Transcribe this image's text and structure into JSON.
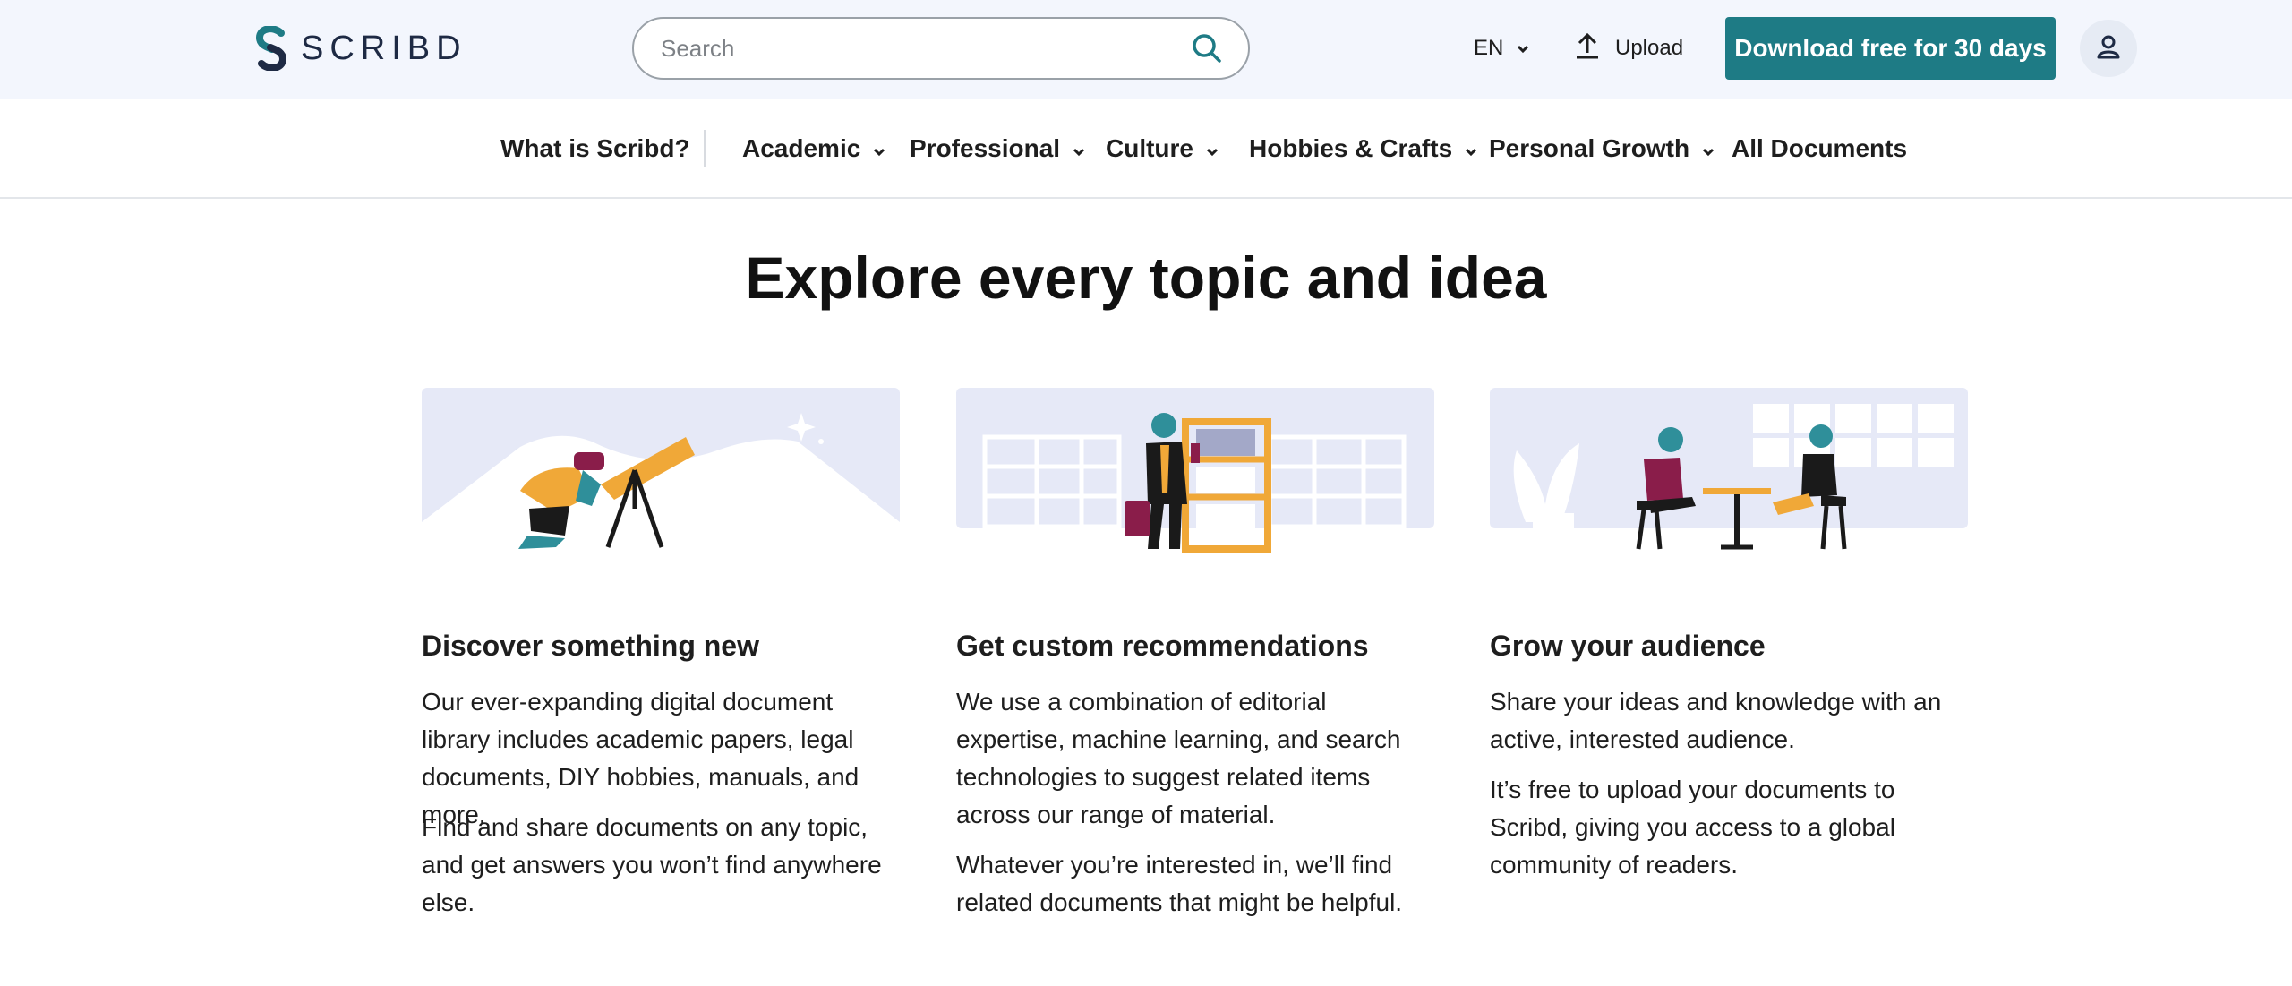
{
  "header": {
    "logo_text": "SCRIBD",
    "search_placeholder": "Search",
    "language": "EN",
    "upload_label": "Upload",
    "cta_label": "Download free for 30 days",
    "brand_color": "#1e7b85",
    "icons": [
      "scribd-logo-icon",
      "search-icon",
      "chevron-down-icon",
      "upload-icon",
      "user-icon"
    ]
  },
  "nav": {
    "items": [
      {
        "label": "What is Scribd?",
        "dropdown": false
      },
      {
        "label": "Academic",
        "dropdown": true
      },
      {
        "label": "Professional",
        "dropdown": true
      },
      {
        "label": "Culture",
        "dropdown": true
      },
      {
        "label": "Hobbies & Crafts",
        "dropdown": true
      },
      {
        "label": "Personal Growth",
        "dropdown": true
      },
      {
        "label": "All Documents",
        "dropdown": false
      }
    ]
  },
  "main": {
    "headline": "Explore every topic and idea",
    "cards": [
      {
        "title": "Discover something new",
        "p1": "Our ever-expanding digital document library includes academic papers, legal documents, DIY hobbies, manuals, and more.",
        "p2": "Find and share documents on any topic, and get answers you won’t find anywhere else."
      },
      {
        "title": "Get custom recommendations",
        "p1": "We use a combination of editorial expertise, machine learning, and search technologies to suggest related items across our range of material.",
        "p2": "Whatever you’re interested in, we’ll find related documents that might be helpful."
      },
      {
        "title": "Grow your audience",
        "p1": "Share your ideas and knowledge with an active, interested audience.",
        "p2": "It’s free to upload your documents to Scribd, giving you access to a global community of readers."
      }
    ]
  }
}
